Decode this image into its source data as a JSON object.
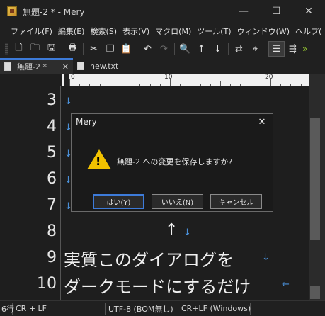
{
  "window": {
    "title": "無題-2 * - Mery",
    "minimize": "—",
    "maximize": "☐",
    "close": "✕"
  },
  "menu": [
    "ファイル(F)",
    "編集(E)",
    "検索(S)",
    "表示(V)",
    "マクロ(M)",
    "ツール(T)",
    "ウィンドウ(W)",
    "ヘルプ("
  ],
  "menu_overflow": "»",
  "toolbar": {
    "icons": [
      "new-file-icon",
      "open-folder-icon",
      "save-icon",
      "print-icon",
      "cut-icon",
      "copy-icon",
      "paste-icon",
      "undo-icon",
      "redo-icon",
      "search-icon",
      "up-arrow-icon",
      "down-arrow-icon",
      "replace-icon",
      "highlight-icon",
      "wrap-icon",
      "indent-icon"
    ],
    "glyphs": [
      "🗋",
      "🗀",
      "🖫",
      "🖶",
      "✂",
      "❐",
      "📋",
      "↶",
      "↷",
      "🔍",
      "↑",
      "↓",
      "⇄",
      "⌖",
      "☰",
      "⇶"
    ],
    "overflow": "»"
  },
  "tabs": [
    {
      "label": "無題-2 *",
      "close": "✕",
      "active": true
    },
    {
      "label": "new.txt",
      "active": false
    }
  ],
  "ruler": {
    "labels": [
      "0",
      "10",
      "20"
    ]
  },
  "editor": {
    "line_numbers": [
      "3",
      "4",
      "5",
      "6",
      "7",
      "8",
      "9",
      "10"
    ],
    "line8_text": "↑",
    "line9_text": "実質このダイアログを",
    "line10_text": "ダークモードにするだけ",
    "eol_mark": "↓",
    "eof_mark": "←"
  },
  "dialog": {
    "title": "Mery",
    "close": "✕",
    "icon": "warning-icon",
    "message": "無題-2 への変更を保存しますか?",
    "buttons": {
      "yes": "はい(Y)",
      "no": "いいえ(N)",
      "cancel": "キャンセル"
    }
  },
  "status": {
    "position": "6行",
    "line_ending_cur": "CR + LF",
    "encoding": "UTF-8 (BOM無し)",
    "line_ending_doc": "CR+LF (Windows)"
  },
  "colors": {
    "accent": "#3d7bd9",
    "eol": "#4a90d9",
    "warning": "#f2c200",
    "overflow": "#9acd32"
  }
}
